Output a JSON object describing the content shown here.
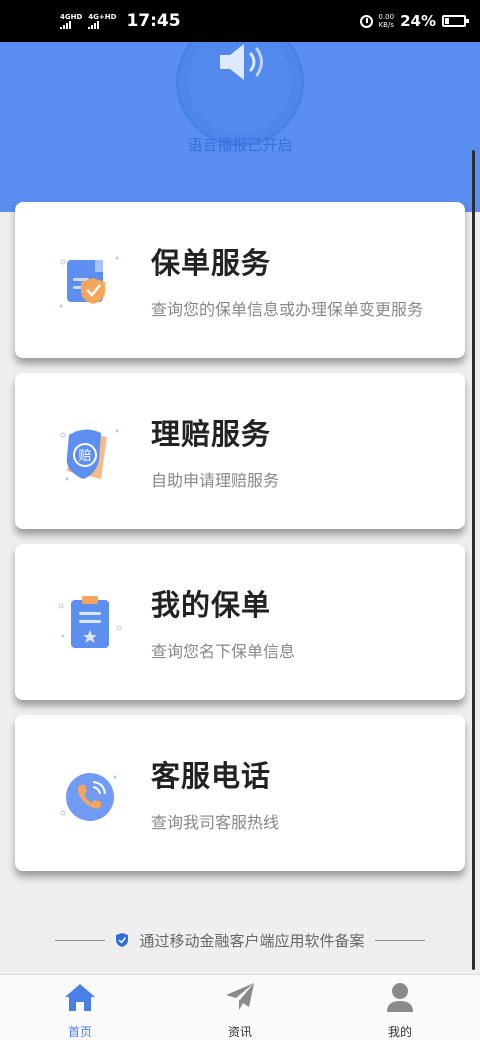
{
  "status_bar": {
    "network_1": "4GHD",
    "network_2": "4G+HD",
    "time": "17:45",
    "speed_value": "0.00",
    "speed_unit": "KB/s",
    "battery": "24%",
    "battery_level": 0.24
  },
  "header": {
    "voice_label": "语音播报已开启",
    "background_color": "#5a8ef0"
  },
  "cards": [
    {
      "title": "保单服务",
      "desc": "查询您的保单信息或办理保单变更服务",
      "icon": "policy-document-icon"
    },
    {
      "title": "理赔服务",
      "desc": "自助申请理赔服务",
      "icon": "claim-icon"
    },
    {
      "title": "我的保单",
      "desc": "查询您名下保单信息",
      "icon": "clipboard-icon"
    },
    {
      "title": "客服电话",
      "desc": "查询我司客服热线",
      "icon": "phone-icon"
    }
  ],
  "record_text": "通过移动金融客户端应用软件备案",
  "bottom_nav": [
    {
      "label": "首页",
      "icon": "home-icon",
      "active": true
    },
    {
      "label": "资讯",
      "icon": "paper-plane-icon",
      "active": false
    },
    {
      "label": "我的",
      "icon": "user-icon",
      "active": false
    }
  ],
  "accent_color": "#4a7fe6"
}
